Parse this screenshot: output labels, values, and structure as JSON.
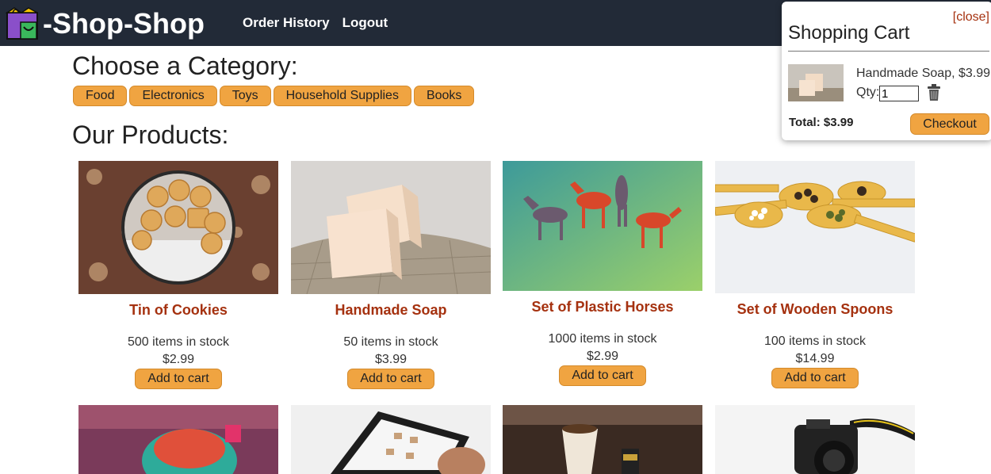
{
  "header": {
    "logo_text": "-Shop-Shop",
    "nav": [
      "Order History",
      "Logout"
    ]
  },
  "categories": {
    "title": "Choose a Category:",
    "items": [
      "Food",
      "Electronics",
      "Toys",
      "Household Supplies",
      "Books"
    ]
  },
  "products": {
    "title": "Our Products:",
    "add_label": "Add to cart",
    "items": [
      {
        "name": "Tin of Cookies",
        "stock": "500 items in stock",
        "price": "$2.99"
      },
      {
        "name": "Handmade Soap",
        "stock": "50 items in stock",
        "price": "$3.99"
      },
      {
        "name": "Set of Plastic Horses",
        "stock": "1000 items in stock",
        "price": "$2.99"
      },
      {
        "name": "Set of Wooden Spoons",
        "stock": "100 items in stock",
        "price": "$14.99"
      }
    ]
  },
  "cart": {
    "close_label": "[close]",
    "title": "Shopping Cart",
    "item_name": "Handmade Soap, $3.99",
    "qty_label": "Qty:",
    "qty_value": "1",
    "total_label": "Total: $3.99",
    "checkout_label": "Checkout"
  },
  "colors": {
    "header_bg": "#222a37",
    "accent": "#f0a441",
    "product_name": "#a5310f"
  }
}
